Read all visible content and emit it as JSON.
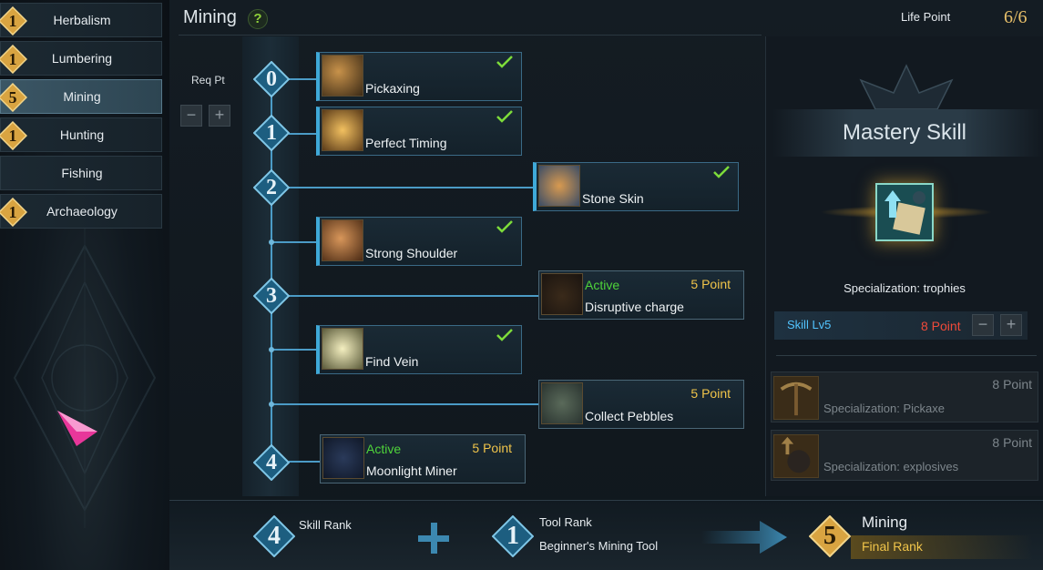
{
  "header": {
    "title": "Mining",
    "help_glyph": "?",
    "life_point_label": "Life Point",
    "life_point_value": "6/6"
  },
  "sidebar": {
    "items": [
      {
        "label": "Herbalism",
        "rank": "1"
      },
      {
        "label": "Lumbering",
        "rank": "1"
      },
      {
        "label": "Mining",
        "rank": "5",
        "selected": true
      },
      {
        "label": "Hunting",
        "rank": "1"
      },
      {
        "label": "Fishing",
        "rank": ""
      },
      {
        "label": "Archaeology",
        "rank": "1"
      }
    ]
  },
  "req_pt": {
    "label": "Req Pt",
    "minus": "−",
    "plus": "+"
  },
  "tree": {
    "ranks": [
      "0",
      "1",
      "2",
      "3",
      "4"
    ],
    "skills": [
      {
        "name": "Pickaxing",
        "learned": true,
        "active_label": "",
        "points": ""
      },
      {
        "name": "Perfect Timing",
        "learned": true,
        "active_label": "",
        "points": ""
      },
      {
        "name": "Stone Skin",
        "learned": true,
        "active_label": "",
        "points": ""
      },
      {
        "name": "Strong Shoulder",
        "learned": true,
        "active_label": "",
        "points": ""
      },
      {
        "name": "Disruptive charge",
        "learned": false,
        "active_label": "Active",
        "points": "5 Point"
      },
      {
        "name": "Find Vein",
        "learned": true,
        "active_label": "",
        "points": ""
      },
      {
        "name": "Collect Pebbles",
        "learned": false,
        "active_label": "",
        "points": "5 Point"
      },
      {
        "name": "Moonlight Miner",
        "learned": false,
        "active_label": "Active",
        "points": "5 Point"
      }
    ]
  },
  "mastery": {
    "title": "Mastery Skill",
    "spec_name": "Specialization: trophies",
    "skill_lv": "Skill Lv5",
    "skill_points": "8 Point",
    "minus": "−",
    "plus": "+",
    "specializations": [
      {
        "name": "Specialization: Pickaxe",
        "points": "8 Point"
      },
      {
        "name": "Specialization: explosives",
        "points": "8 Point"
      }
    ]
  },
  "footer": {
    "skill_rank_value": "4",
    "skill_rank_label": "Skill Rank",
    "tool_rank_value": "1",
    "tool_rank_label": "Tool Rank",
    "tool_name": "Beginner's Mining Tool",
    "final_value": "5",
    "final_title": "Mining",
    "final_label": "Final Rank"
  },
  "colors": {
    "accent_blue": "#3fa9d8",
    "active_green": "#4fd43a",
    "point_gold": "#f0c44a",
    "skill_point_red": "#f04a3a",
    "gold": "#d9a441"
  }
}
